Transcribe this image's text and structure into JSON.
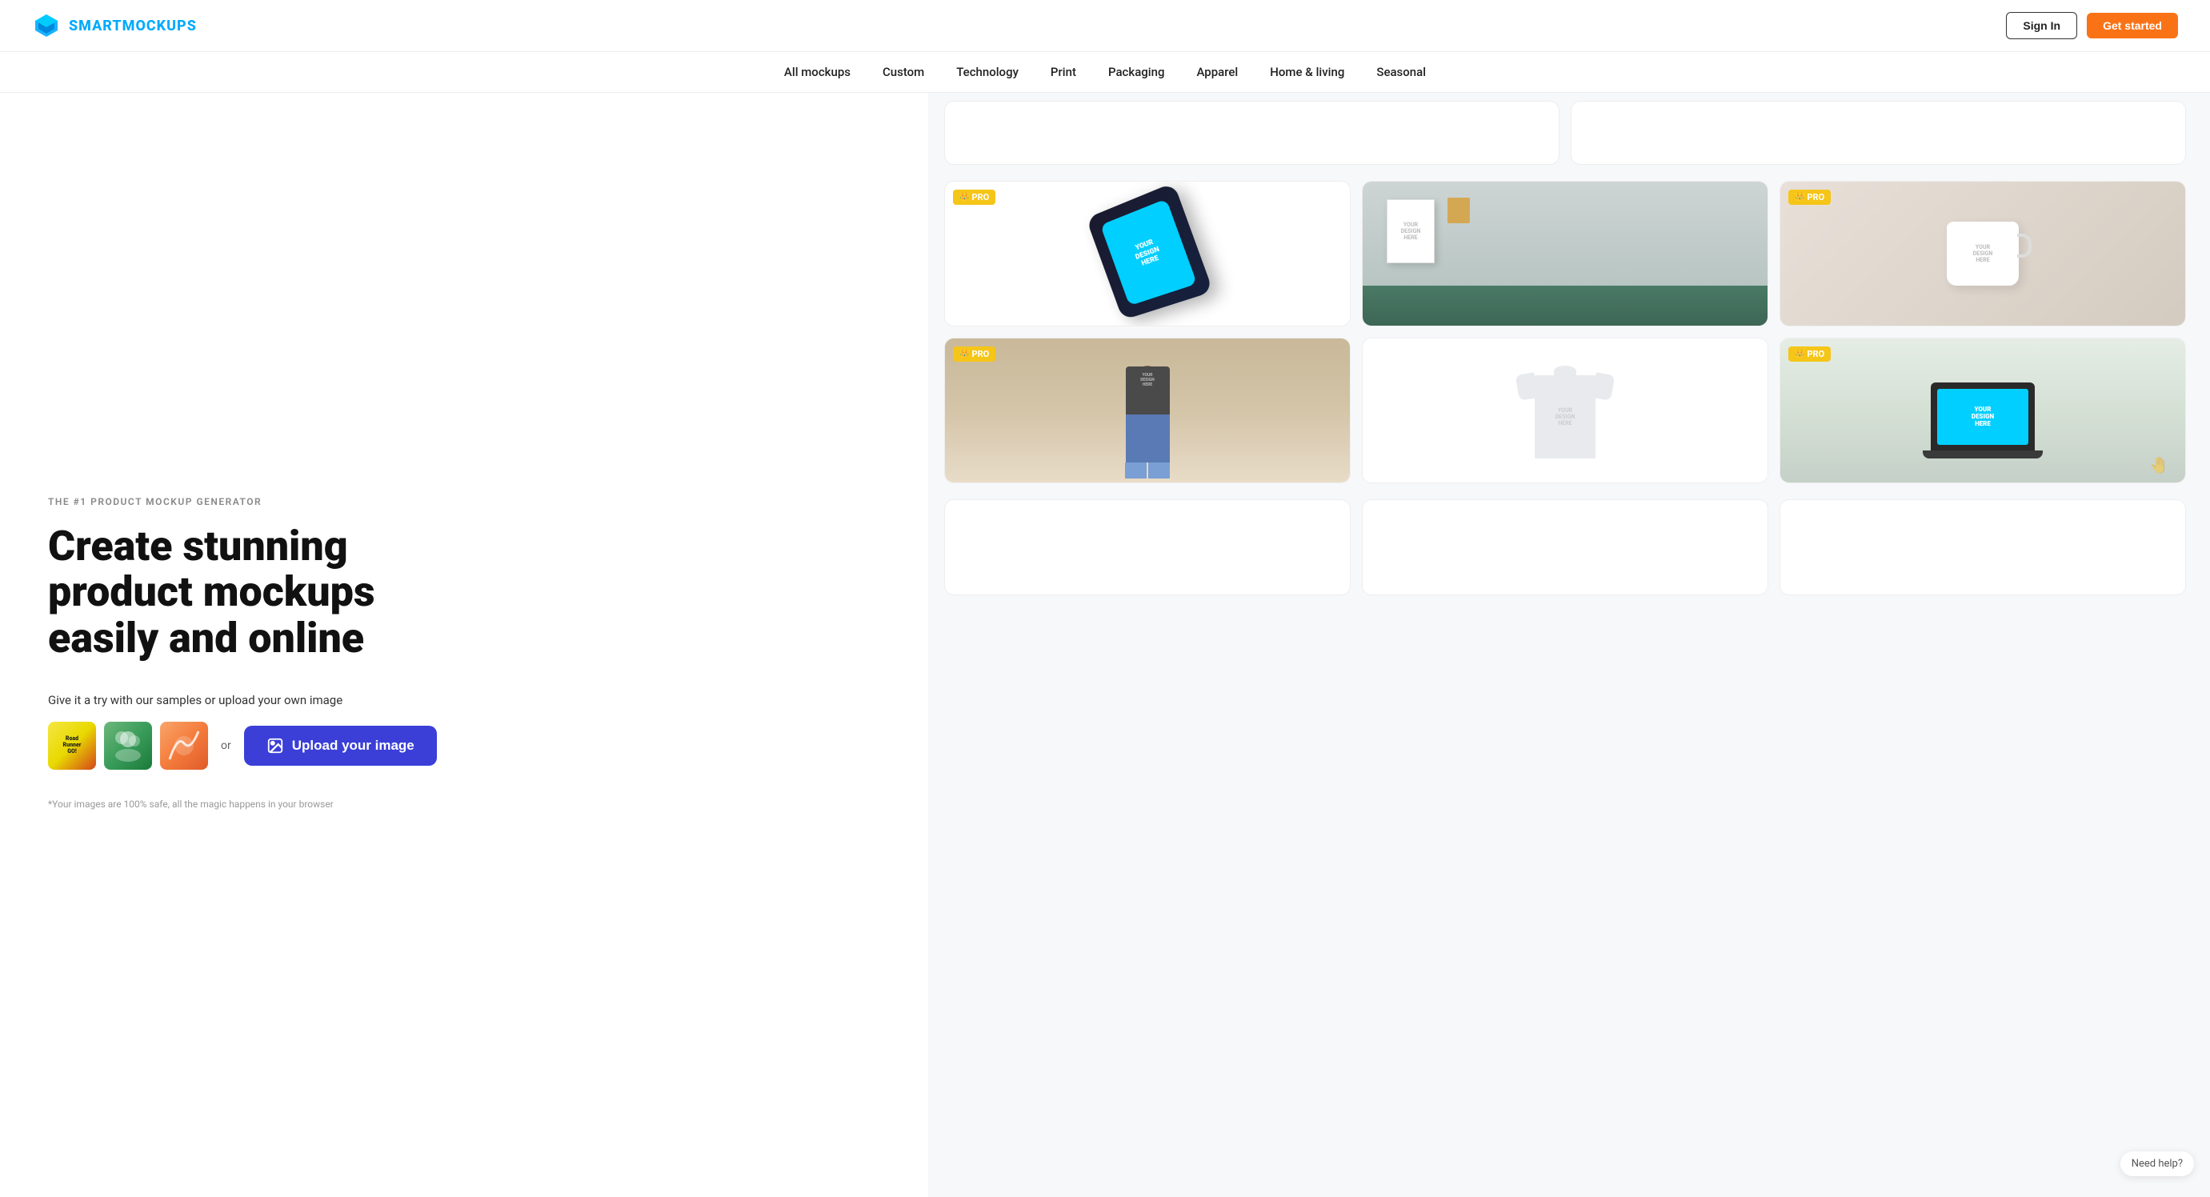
{
  "header": {
    "logo_text": "SMARTMOCKUPS",
    "signin_label": "Sign In",
    "getstarted_label": "Get started"
  },
  "nav": {
    "items": [
      {
        "label": "All mockups",
        "id": "all-mockups"
      },
      {
        "label": "Custom",
        "id": "custom"
      },
      {
        "label": "Technology",
        "id": "technology"
      },
      {
        "label": "Print",
        "id": "print"
      },
      {
        "label": "Packaging",
        "id": "packaging"
      },
      {
        "label": "Apparel",
        "id": "apparel"
      },
      {
        "label": "Home & living",
        "id": "home-living"
      },
      {
        "label": "Seasonal",
        "id": "seasonal"
      }
    ]
  },
  "hero": {
    "subtitle": "THE #1 PRODUCT MOCKUP GENERATOR",
    "title_line1": "Create stunning",
    "title_line2": "product mockups",
    "title_line3": "easily and online",
    "try_text": "Give it a try with our samples or upload your own image",
    "or_label": "or",
    "upload_label": "Upload your image",
    "disclaimer": "*Your images are 100% safe, all the magic happens in your browser"
  },
  "mockups": {
    "pro_badge": "PRO",
    "phone": {
      "screen_text": "YOUR\nDESIGN\nHERE",
      "is_pro": true
    },
    "poster_room": {
      "design_text": "YOUR\nDESIGN\nHERE",
      "is_pro": false
    },
    "mug": {
      "design_text": "YOUR\nDESIGN\nHERE",
      "is_pro": true
    },
    "person_tshirt": {
      "design_text": "YOUR\nDESIGN\nHERE",
      "is_pro": true
    },
    "tshirt_flat": {
      "design_text": "YOUR\nDESIGN\nHERE",
      "is_pro": false
    },
    "laptop": {
      "screen_text": "YOUR\nDESIGN\nHERE",
      "is_pro": true
    }
  },
  "footer": {
    "need_help": "Need help?"
  },
  "colors": {
    "accent_blue": "#00aaff",
    "accent_orange": "#f97316",
    "pro_gold": "#f5c518",
    "upload_blue": "#3b3fd8",
    "phone_screen": "#00cfff",
    "laptop_screen": "#00cfff"
  }
}
